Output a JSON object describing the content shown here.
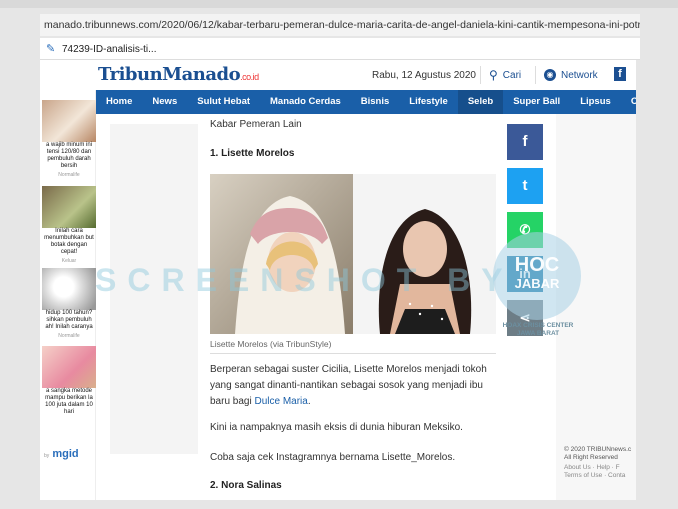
{
  "browser": {
    "url": "manado.tribunnews.com/2020/06/12/kabar-terbaru-pemeran-dulce-maria-carita-de-angel-daniela-kini-cantik-mempesona-ini-potretnya",
    "tab_title": "74239-ID-analisis-ti..."
  },
  "header": {
    "logo_text": "TribunManado",
    "logo_suffix": ".co.id",
    "date": "Rabu, 12 Agustus 2020",
    "search_label": "Cari",
    "network_label": "Network"
  },
  "nav": {
    "items": [
      "Home",
      "News",
      "Sulut Hebat",
      "Manado Cerdas",
      "Bisnis",
      "Lifestyle",
      "Seleb",
      "Super Ball",
      "Lipsus",
      "Citizen Journalism"
    ],
    "active": "Seleb"
  },
  "left_ads": [
    {
      "text": "a wajib minum ini tensi 120/80 dan pembuluh darah bersih",
      "source": "Normalife"
    },
    {
      "text": "Inilah cara menumbuhkan but botak dengan cepat!",
      "source": "Keluar"
    },
    {
      "text": "hidup 100 tahun? sihkan pembuluh ah! Inilah caranya",
      "source": "Normalife"
    },
    {
      "text": "a sangka metode mampu berikan la 100 juta dalam 10 hari",
      "source": ""
    }
  ],
  "mgid": {
    "prefix": "by",
    "brand": "mgid"
  },
  "article": {
    "section_title": "Kabar Pemeran Lain",
    "heading_1": "1. Lisette Morelos",
    "caption": "Lisette Morelos (via TribunStyle)",
    "para1_text": "Berperan sebagai suster Cicilia, Lisette Morelos menjadi tokoh yang sangat dinanti-nantikan sebagai sosok yang menjadi ibu baru bagi ",
    "para1_link": "Dulce Maria",
    "para1_end": ".",
    "para2": "Kini ia nampaknya masih eksis di dunia hiburan Meksiko.",
    "para3": "Coba saja cek Instagramnya bernama Lisette_Morelos.",
    "heading_2": "2. Nora Salinas"
  },
  "share": [
    "f",
    "t",
    "w",
    "in",
    "<"
  ],
  "footer": {
    "copyright": "© 2020 TRIBUNnews.c All Right Reserved",
    "links": "About Us · Help · F Terms of Use · Conta"
  },
  "watermark": {
    "text": "SCREENSHOT BY",
    "badge_1": "HOC",
    "badge_2": "JABAR",
    "badge_sub": "HOAX CRISIS CENTER JAWA BARAT"
  },
  "colors": {
    "nav_bg": "#1a5fa8",
    "facebook": "#3b5998",
    "twitter": "#1da1f2",
    "whatsapp": "#25d366",
    "linkedin": "#0e76a8",
    "share_other": "#6d7d86"
  }
}
